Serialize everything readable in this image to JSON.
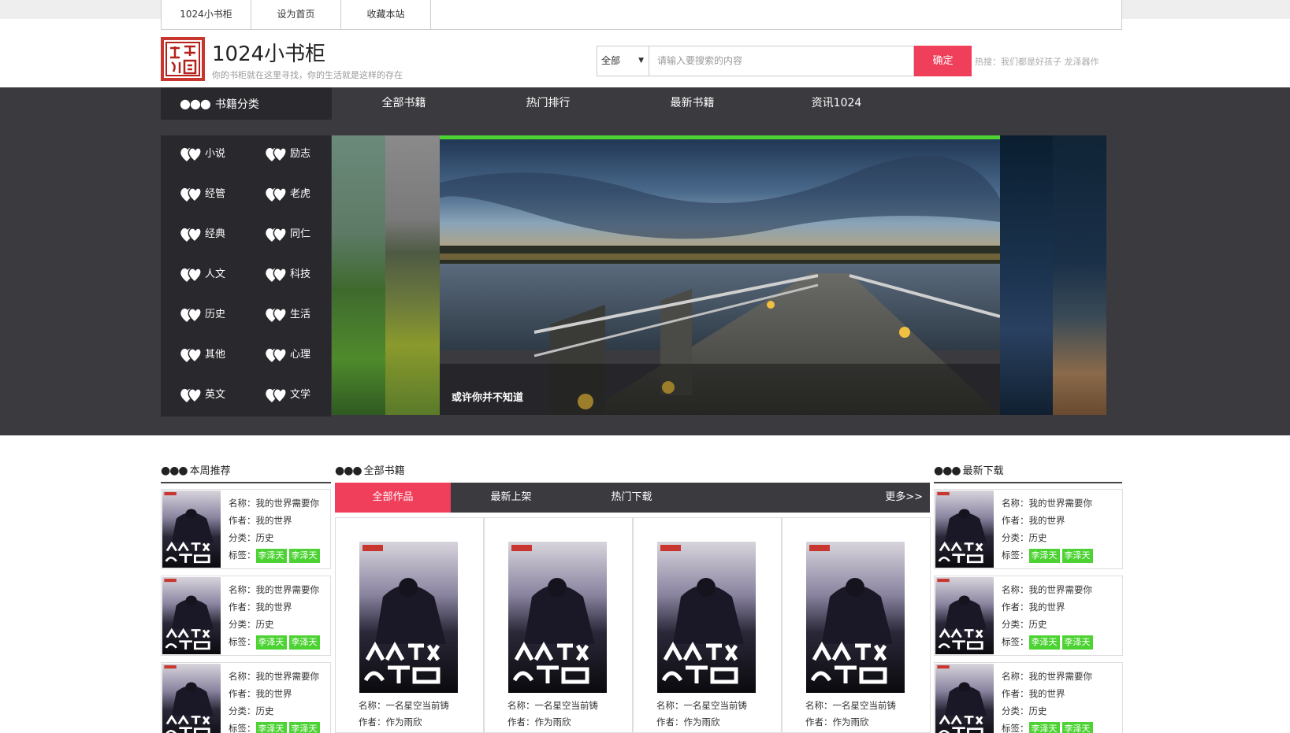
{
  "topbar": {
    "links": [
      "1024小书柜",
      "设为首页",
      "收藏本站"
    ]
  },
  "header": {
    "title": "1024小书柜",
    "subtitle": "你的书柜就在这里寻找，你的生活就是这样的存在",
    "search_select": "全部",
    "search_placeholder": "请输入要搜索的内容",
    "search_button": "确定",
    "hot": "热搜：我们都是好孩子 龙泽器作"
  },
  "nav": {
    "category_label": "书籍分类",
    "items": [
      "全部书籍",
      "热门排行",
      "最新书籍",
      "资讯1024"
    ]
  },
  "categories": [
    "小说",
    "励志",
    "经管",
    "老虎",
    "经典",
    "同仁",
    "人文",
    "科技",
    "历史",
    "生活",
    "其他",
    "心理",
    "英文",
    "文学"
  ],
  "carousel": {
    "caption": "或许你并不知道"
  },
  "recommend": {
    "title": "本周推荐",
    "items": [
      {
        "name": "名称：我的世界需要你",
        "author": "作者：我的世界",
        "category": "分类：历史",
        "tag_label": "标签：",
        "tags": [
          "李泽天",
          "李泽天"
        ]
      },
      {
        "name": "名称：我的世界需要你",
        "author": "作者：我的世界",
        "category": "分类：历史",
        "tag_label": "标签：",
        "tags": [
          "李泽天",
          "李泽天"
        ]
      },
      {
        "name": "名称：我的世界需要你",
        "author": "作者：我的世界",
        "category": "分类：历史",
        "tag_label": "标签：",
        "tags": [
          "李泽天",
          "李泽天"
        ]
      }
    ]
  },
  "all_books": {
    "title": "全部书籍",
    "tabs": [
      "全部作品",
      "最新上架",
      "热门下载"
    ],
    "more": "更多>>",
    "books": [
      {
        "name": "名称：一名星空当前铸",
        "author": "作者：作为雨欣"
      },
      {
        "name": "名称：一名星空当前铸",
        "author": "作者：作为雨欣"
      },
      {
        "name": "名称：一名星空当前铸",
        "author": "作者：作为雨欣"
      },
      {
        "name": "名称：一名星空当前铸",
        "author": "作者：作为雨欣"
      }
    ]
  },
  "latest": {
    "title": "最新下载",
    "items": [
      {
        "name": "名称：我的世界需要你",
        "author": "作者：我的世界",
        "category": "分类：历史",
        "tag_label": "标签：",
        "tags": [
          "李泽天",
          "李泽天"
        ]
      },
      {
        "name": "名称：我的世界需要你",
        "author": "作者：我的世界",
        "category": "分类：历史",
        "tag_label": "标签：",
        "tags": [
          "李泽天",
          "李泽天"
        ]
      },
      {
        "name": "名称：我的世界需要你",
        "author": "作者：我的世界",
        "category": "分类：历史",
        "tag_label": "标签：",
        "tags": [
          "李泽天",
          "李泽天"
        ]
      }
    ]
  },
  "colors": {
    "accent": "#ef3f5a",
    "tag": "#4cd333",
    "dark": "#3b3a3f"
  }
}
